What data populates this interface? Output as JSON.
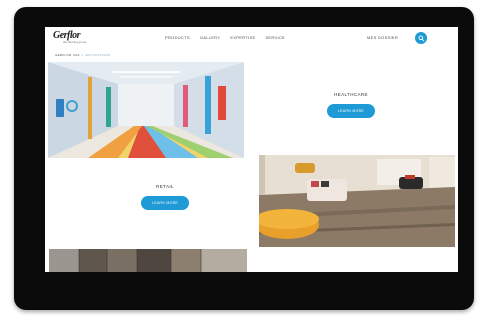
{
  "header": {
    "logo_text": "Gerflor",
    "logo_sub": "the flooring group",
    "nav": [
      "PRODUCTS",
      "GALLERY",
      "EXPERTISE",
      "SERVICE"
    ],
    "signin": "MES DOSSIER"
  },
  "breadcrumb": {
    "home": "GERFLOR USA",
    "current": "APPLICATIONS"
  },
  "sections": {
    "healthcare": {
      "title": "HEALTHCARE",
      "cta": "LEARN MORE"
    },
    "retail": {
      "title": "RETAIL",
      "cta": "LEARN MORE"
    }
  },
  "colors": {
    "accent": "#1e9bd7",
    "monitor_bezel": "#0b0b0b"
  }
}
